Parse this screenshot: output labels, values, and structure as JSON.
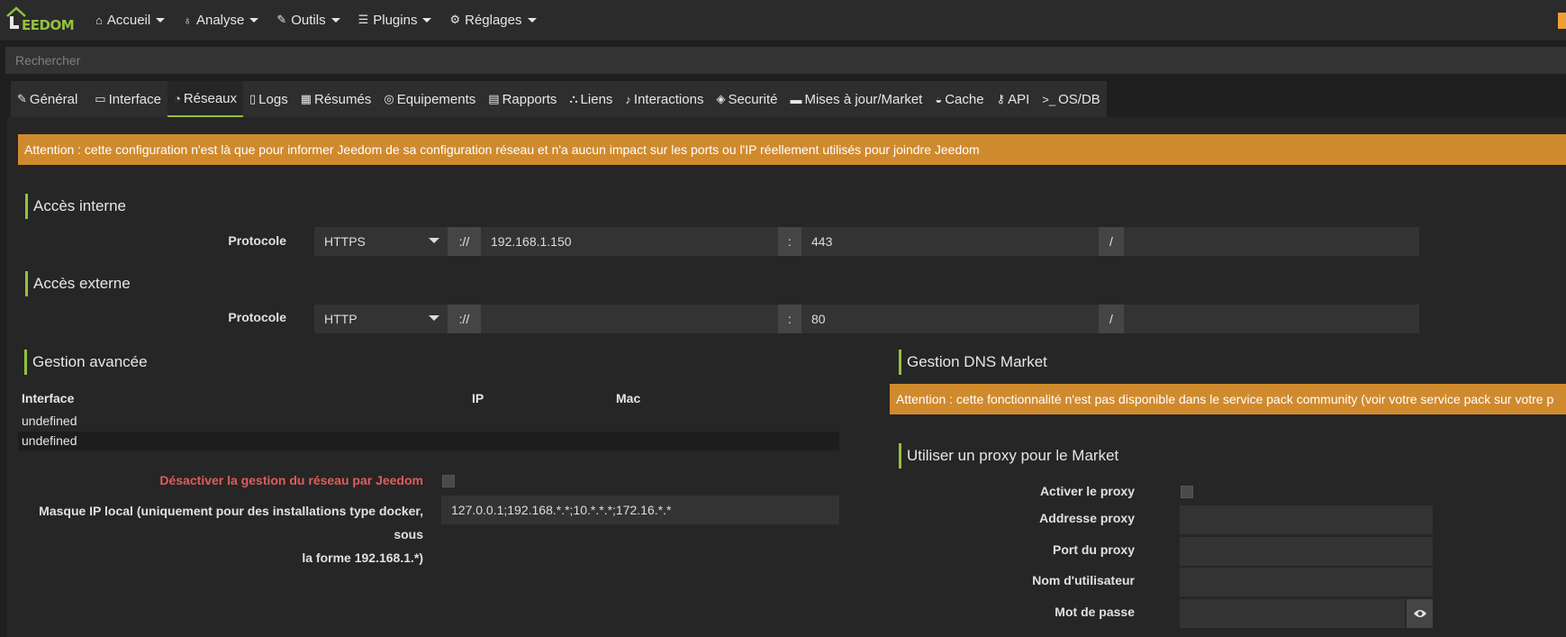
{
  "navbar": {
    "logo_text": "EEDOM",
    "menu": [
      {
        "label": "Accueil",
        "icon": "home-icon"
      },
      {
        "label": "Analyse",
        "icon": "stethoscope-icon"
      },
      {
        "label": "Outils",
        "icon": "wrench-icon"
      },
      {
        "label": "Plugins",
        "icon": "tasks-icon"
      },
      {
        "label": "Réglages",
        "icon": "cog-icon"
      }
    ],
    "badge_color": "#f0a030"
  },
  "search": {
    "placeholder": "Rechercher"
  },
  "tabs": [
    {
      "label": "Général",
      "icon": "wrench-icon"
    },
    {
      "label": "Interface",
      "icon": "laptop-icon"
    },
    {
      "label": "Réseaux",
      "icon": "rss-icon",
      "active": true
    },
    {
      "label": "Logs",
      "icon": "file-icon"
    },
    {
      "label": "Résumés",
      "icon": "table-icon"
    },
    {
      "label": "Equipements",
      "icon": "equipment-icon"
    },
    {
      "label": "Rapports",
      "icon": "report-icon"
    },
    {
      "label": "Liens",
      "icon": "sitemap-icon"
    },
    {
      "label": "Interactions",
      "icon": "microphone-icon"
    },
    {
      "label": "Securité",
      "icon": "shield-icon"
    },
    {
      "label": "Mises à jour/Market",
      "icon": "credit-card-icon"
    },
    {
      "label": "Cache",
      "icon": "car-icon"
    },
    {
      "label": "API",
      "icon": "key-icon"
    },
    {
      "label": "OS/DB",
      "icon": "terminal-icon"
    }
  ],
  "alert_top": "Attention : cette configuration n'est là que pour informer Jeedom de sa configuration réseau et n'a aucun impact sur les ports ou l'IP réellement utilisés pour joindre Jeedom",
  "internal": {
    "title": "Accès interne",
    "protocol_label": "Protocole",
    "protocol": "HTTPS",
    "sep_scheme": "://",
    "host": "192.168.1.150",
    "sep_port": ":",
    "port": "443",
    "sep_path": "/",
    "path": ""
  },
  "external": {
    "title": "Accès externe",
    "protocol_label": "Protocole",
    "protocol": "HTTP",
    "sep_scheme": "://",
    "host": "",
    "sep_port": ":",
    "port": "80",
    "sep_path": "/",
    "path": ""
  },
  "advanced": {
    "title": "Gestion avancée",
    "headers": {
      "interface": "Interface",
      "ip": "IP",
      "mac": "Mac"
    },
    "rows": [
      {
        "interface": "undefined",
        "ip": "",
        "mac": ""
      },
      {
        "interface": "undefined",
        "ip": "",
        "mac": ""
      }
    ],
    "disable_label": "Désactiver la gestion du réseau par Jeedom",
    "mask_label_line1": "Masque IP local (uniquement pour des installations type docker, sous",
    "mask_label_line2": "la forme 192.168.1.*)",
    "mask_value": "127.0.0.1;192.168.*.*;10.*.*.*;172.16.*.*"
  },
  "dns": {
    "title": "Gestion DNS Market",
    "alert": "Attention : cette fonctionnalité n'est pas disponible dans le service pack community (voir votre service pack sur votre p"
  },
  "proxy": {
    "title": "Utiliser un proxy pour le Market",
    "enable_label": "Activer le proxy",
    "address_label": "Addresse proxy",
    "port_label": "Port du proxy",
    "user_label": "Nom d'utilisateur",
    "password_label": "Mot de passe"
  },
  "colors": {
    "accent": "#94c23e",
    "warning": "#d08a2e",
    "danger_text": "#e05c5c"
  }
}
